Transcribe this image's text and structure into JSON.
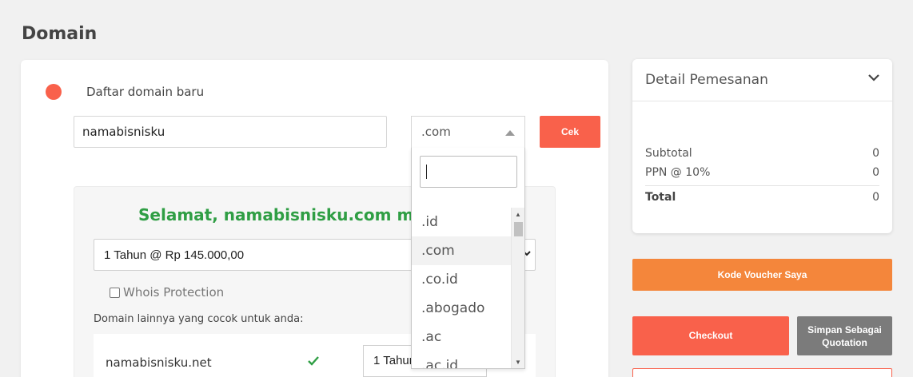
{
  "page": {
    "title": "Domain"
  },
  "domain_form": {
    "option_label": "Daftar domain baru",
    "domain_value": "namabisnisku",
    "tld_value": ".com",
    "check_label": "Cek"
  },
  "tld_dropdown": {
    "search_value": "",
    "options": [
      ".id",
      ".com",
      ".co.id",
      ".abogado",
      ".ac",
      ".ac.id"
    ],
    "selected": ".com"
  },
  "result": {
    "heading": "Selamat, namabisnisku.com masih",
    "period_value": "1 Tahun @ Rp 145.000,00",
    "whois_label": "Whois Protection",
    "suggest_label": "Domain lainnya yang cocok untuk anda:",
    "suggestions": [
      {
        "domain": "namabisnisku.net",
        "period": "1 Tahun"
      }
    ]
  },
  "order": {
    "title": "Detail Pemesanan",
    "subtotal_label": "Subtotal",
    "subtotal_value": "0",
    "tax_label": "PPN @ 10%",
    "tax_value": "0",
    "total_label": "Total",
    "total_value": "0"
  },
  "actions": {
    "voucher_label": "Kode Voucher Saya",
    "checkout_label": "Checkout",
    "quotation_line1": "Simpan Sebagai",
    "quotation_line2": "Quotation"
  },
  "colors": {
    "primary": "#f9614b",
    "voucher": "#f4863b",
    "success": "#2f9e44",
    "secondary": "#7b7b7b"
  }
}
